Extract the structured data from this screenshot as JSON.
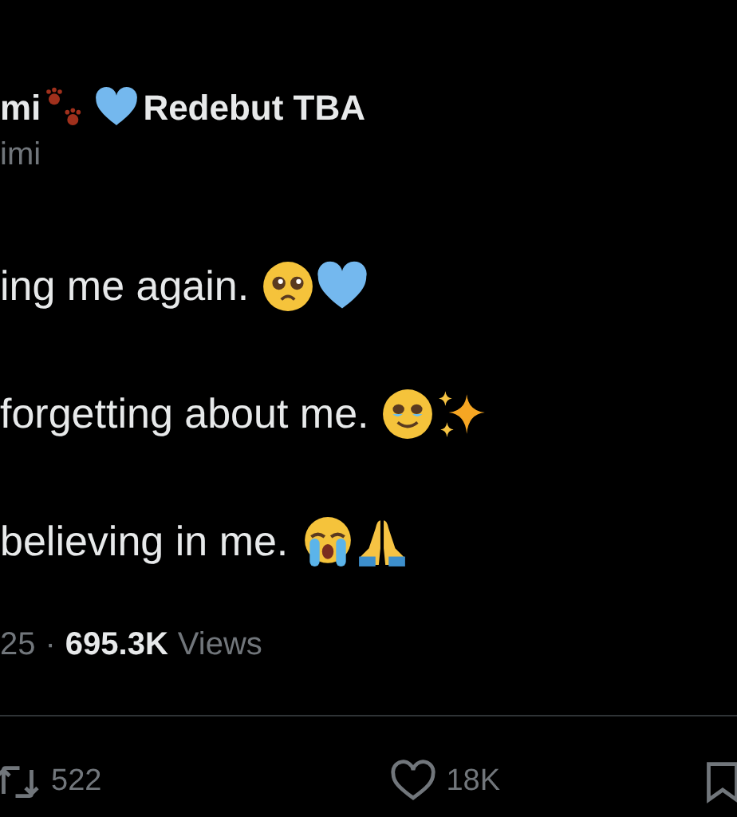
{
  "author": {
    "name_start": "mi",
    "name_emojis": [
      {
        "kind": "paws"
      },
      {
        "kind": "heart"
      }
    ],
    "name_end": "Redebut TBA",
    "handle": "imi"
  },
  "lines": [
    {
      "text": "ing me again.",
      "emojis": [
        {
          "kind": "pleading"
        },
        {
          "kind": "heart"
        }
      ]
    },
    {
      "text": "forgetting about me.",
      "emojis": [
        {
          "kind": "smile-tear"
        },
        {
          "kind": "sparkles"
        }
      ]
    },
    {
      "text": "believing in me.",
      "emojis": [
        {
          "kind": "sob"
        },
        {
          "kind": "pray"
        }
      ]
    }
  ],
  "meta": {
    "date": "25",
    "separator": "·",
    "views": "695.3K",
    "views_label": "Views"
  },
  "actions": [
    {
      "kind": "repost",
      "count": "522"
    },
    {
      "kind": "like",
      "count": "18K"
    },
    {
      "kind": "bookmark"
    }
  ]
}
